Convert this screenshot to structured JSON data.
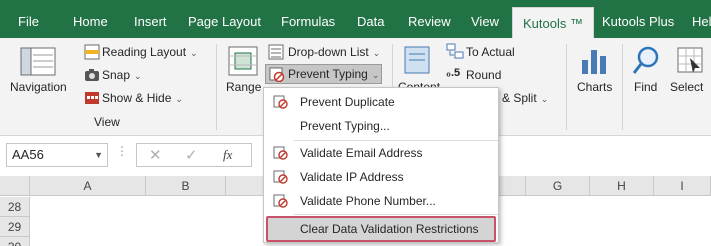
{
  "tabs": {
    "file": "File",
    "home": "Home",
    "insert": "Insert",
    "page_layout": "Page Layout",
    "formulas": "Formulas",
    "data": "Data",
    "review": "Review",
    "view": "View",
    "kutools": "Kutools ™",
    "kutools_plus": "Kutools Plus",
    "help": "Help"
  },
  "ribbon": {
    "navigation": "Navigation",
    "reading_layout": "Reading Layout",
    "snap": "Snap",
    "show_hide": "Show & Hide",
    "view_group": "View",
    "range": "Range",
    "dropdown_list": "Drop-down List",
    "prevent_typing": "Prevent Typing",
    "content": "Content",
    "to_actual": "To Actual",
    "round": "Round",
    "merge_split": "& Split",
    "charts": "Charts",
    "find": "Find",
    "select": "Select"
  },
  "formula_bar": {
    "name_box": "AA56",
    "fx": "fx"
  },
  "columns": [
    "A",
    "B",
    "G",
    "H",
    "I"
  ],
  "rows": [
    "28",
    "29",
    "30"
  ],
  "menu": {
    "items": [
      "Prevent Duplicate",
      "Prevent Typing...",
      "Validate Email Address",
      "Validate IP Address",
      "Validate Phone Number...",
      "Clear Data Validation Restrictions"
    ]
  },
  "colors": {
    "excel_green": "#217346",
    "highlight_border": "#c8526a",
    "icon_red": "#c0392b"
  }
}
